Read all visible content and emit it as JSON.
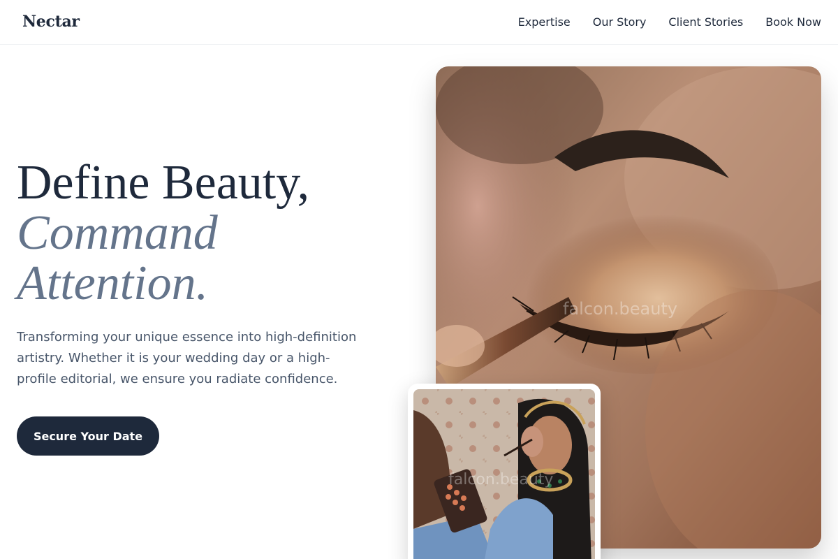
{
  "header": {
    "brand": "Nectar",
    "nav": [
      {
        "label": "Expertise"
      },
      {
        "label": "Our Story"
      },
      {
        "label": "Client Stories"
      },
      {
        "label": "Book Now"
      }
    ]
  },
  "hero": {
    "title_line1": "Define Beauty,",
    "title_accent": "Command Attention.",
    "description": "Transforming your unique essence into high-definition artistry. Whether it is your wedding day or a high-profile editorial, we ensure you radiate confidence.",
    "cta_label": "Secure Your Date"
  },
  "images": {
    "main_watermark": "falcon.beauty",
    "secondary_watermark": "falcon.beauty"
  },
  "colors": {
    "primary": "#1e293b",
    "accent_text": "#64748b",
    "body_text": "#475569",
    "background": "#ffffff"
  }
}
